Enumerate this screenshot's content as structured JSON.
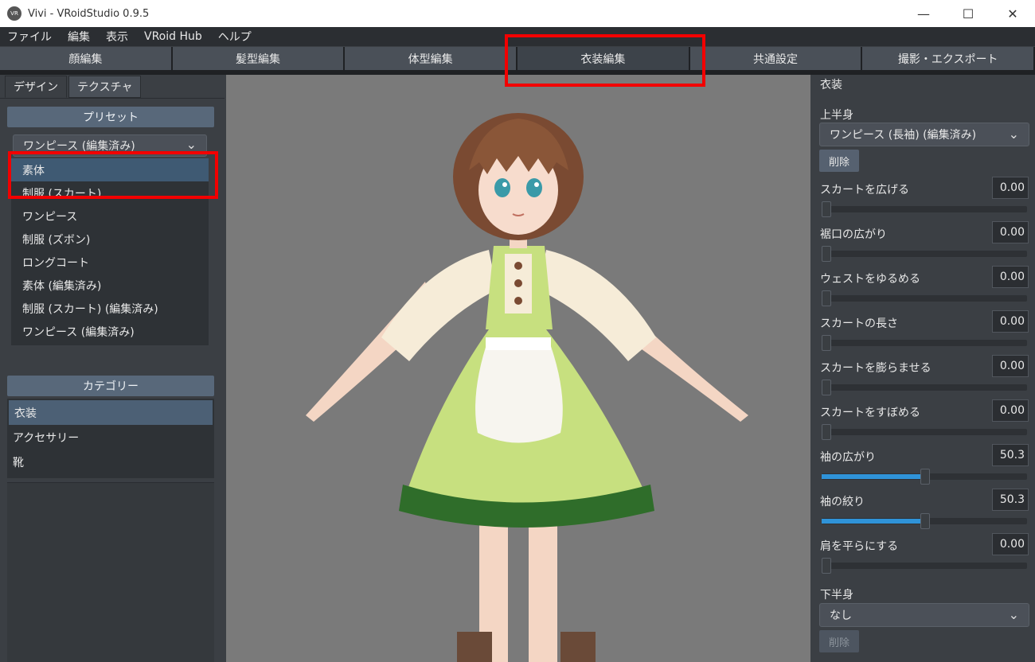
{
  "window": {
    "title": "Vivi - VRoidStudio 0.9.5",
    "icon_label": "VR",
    "controls": {
      "minimize": "—",
      "maximize": "☐",
      "close": "✕"
    }
  },
  "menu": {
    "items": [
      {
        "label": "ファイル"
      },
      {
        "label": "編集"
      },
      {
        "label": "表示"
      },
      {
        "label": "VRoid Hub"
      },
      {
        "label": "ヘルプ"
      }
    ]
  },
  "main_tabs": [
    {
      "label": "顔編集",
      "active": false
    },
    {
      "label": "髪型編集",
      "active": false
    },
    {
      "label": "体型編集",
      "active": false
    },
    {
      "label": "衣装編集",
      "active": true
    },
    {
      "label": "共通設定",
      "active": false
    },
    {
      "label": "撮影・エクスポート",
      "active": false
    }
  ],
  "left": {
    "sub_tabs": [
      {
        "label": "デザイン",
        "active": true
      },
      {
        "label": "テクスチャ",
        "active": false
      }
    ],
    "preset_header": "プリセット",
    "preset_selected": "ワンピース (編集済み)",
    "preset_options": [
      {
        "label": "素体",
        "selected": true
      },
      {
        "label": "制服 (スカート)",
        "selected": false
      },
      {
        "label": "ワンピース",
        "selected": false
      },
      {
        "label": "制服 (ズボン)",
        "selected": false
      },
      {
        "label": "ロングコート",
        "selected": false
      },
      {
        "label": "素体 (編集済み)",
        "selected": false
      },
      {
        "label": "制服 (スカート) (編集済み)",
        "selected": false
      },
      {
        "label": "ワンピース (編集済み)",
        "selected": false
      }
    ],
    "category_header": "カテゴリー",
    "categories": [
      {
        "label": "衣装",
        "selected": true
      },
      {
        "label": "アクセサリー",
        "selected": false
      },
      {
        "label": "靴",
        "selected": false
      }
    ]
  },
  "right": {
    "title": "衣装",
    "upper_label": "上半身",
    "upper_selected": "ワンピース (長袖) (編集済み)",
    "delete_label": "削除",
    "params": [
      {
        "label": "スカートを広げる",
        "value": "0.00",
        "fraction": 0.0
      },
      {
        "label": "裾口の広がり",
        "value": "0.00",
        "fraction": 0.0
      },
      {
        "label": "ウェストをゆるめる",
        "value": "0.00",
        "fraction": 0.0
      },
      {
        "label": "スカートの長さ",
        "value": "0.00",
        "fraction": 0.0
      },
      {
        "label": "スカートを膨らませる",
        "value": "0.00",
        "fraction": 0.0
      },
      {
        "label": "スカートをすぼめる",
        "value": "0.00",
        "fraction": 0.0
      },
      {
        "label": "袖の広がり",
        "value": "50.3",
        "fraction": 0.503
      },
      {
        "label": "袖の絞り",
        "value": "50.3",
        "fraction": 0.503
      },
      {
        "label": "肩を平らにする",
        "value": "0.00",
        "fraction": 0.0
      }
    ],
    "lower_label": "下半身",
    "lower_selected": "なし",
    "lower_delete_label": "削除"
  },
  "colors": {
    "accent": "#2f93d8",
    "highlight": "#f20000",
    "viewport_bg": "#7a7a7a"
  }
}
